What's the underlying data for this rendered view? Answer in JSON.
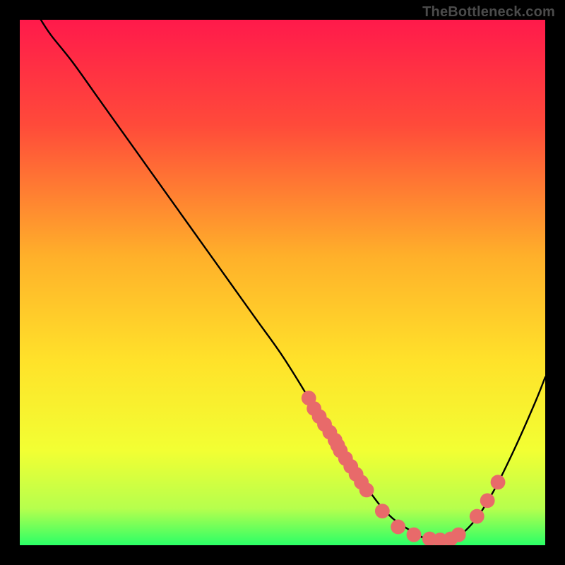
{
  "watermark": "TheBottleneck.com",
  "chart_data": {
    "type": "line",
    "title": "",
    "xlabel": "",
    "ylabel": "",
    "xlim": [
      0,
      100
    ],
    "ylim": [
      0,
      100
    ],
    "gradient_stops": [
      {
        "offset": 0.0,
        "color": "#ff1a4b"
      },
      {
        "offset": 0.2,
        "color": "#ff4a3a"
      },
      {
        "offset": 0.45,
        "color": "#ffb02a"
      },
      {
        "offset": 0.65,
        "color": "#ffe22a"
      },
      {
        "offset": 0.82,
        "color": "#f2ff33"
      },
      {
        "offset": 0.93,
        "color": "#b6ff4d"
      },
      {
        "offset": 1.0,
        "color": "#2bff67"
      }
    ],
    "curve": {
      "name": "bottleneck-curve",
      "x": [
        4,
        6,
        10,
        15,
        20,
        25,
        30,
        35,
        40,
        45,
        50,
        55,
        58,
        62,
        66,
        70,
        74,
        78,
        82,
        86,
        90,
        94,
        98,
        100
      ],
      "y": [
        100,
        97,
        92,
        85,
        78,
        71,
        64,
        57,
        50,
        43,
        36,
        28,
        23,
        17,
        11,
        6,
        3,
        1,
        1,
        4,
        10,
        18,
        27,
        32
      ]
    },
    "markers": {
      "name": "highlight-dots",
      "color": "#e86a6a",
      "radius": 1.4,
      "points": [
        {
          "x": 55,
          "y": 28
        },
        {
          "x": 56,
          "y": 26
        },
        {
          "x": 57,
          "y": 24.5
        },
        {
          "x": 58,
          "y": 23
        },
        {
          "x": 59,
          "y": 21.5
        },
        {
          "x": 60,
          "y": 20
        },
        {
          "x": 60.5,
          "y": 19
        },
        {
          "x": 61,
          "y": 18
        },
        {
          "x": 62,
          "y": 16.5
        },
        {
          "x": 63,
          "y": 15
        },
        {
          "x": 64,
          "y": 13.5
        },
        {
          "x": 65,
          "y": 12
        },
        {
          "x": 66,
          "y": 10.5
        },
        {
          "x": 69,
          "y": 6.5
        },
        {
          "x": 72,
          "y": 3.5
        },
        {
          "x": 75,
          "y": 2
        },
        {
          "x": 78,
          "y": 1.2
        },
        {
          "x": 80,
          "y": 1.0
        },
        {
          "x": 82,
          "y": 1.2
        },
        {
          "x": 83.5,
          "y": 2.0
        },
        {
          "x": 87,
          "y": 5.5
        },
        {
          "x": 89,
          "y": 8.5
        },
        {
          "x": 91,
          "y": 12
        }
      ]
    }
  }
}
